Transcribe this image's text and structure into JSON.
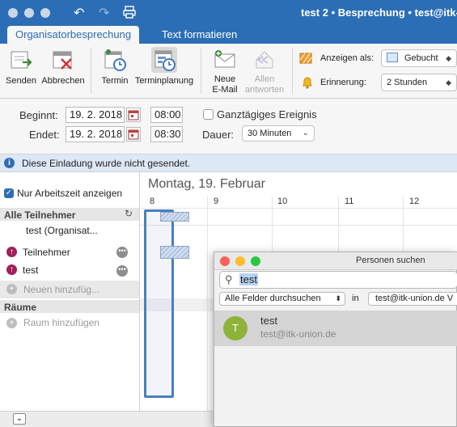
{
  "window": {
    "title": "test 2 • Besprechung • test@itk-"
  },
  "tabs": [
    {
      "label": "Organisatorbesprechung",
      "active": true
    },
    {
      "label": "Text formatieren",
      "active": false
    }
  ],
  "ribbon": {
    "buttons": [
      {
        "label": "Senden"
      },
      {
        "label": "Abbrechen"
      },
      {
        "label": "Termin"
      },
      {
        "label": "Terminplanung"
      },
      {
        "label_line1": "Neue",
        "label_line2": "E-Mail"
      },
      {
        "label_line1": "Allen",
        "label_line2": "antworten"
      }
    ],
    "show_as": {
      "label": "Anzeigen als:",
      "value": "Gebucht"
    },
    "reminder": {
      "label": "Erinnerung:",
      "value": "2 Stunden"
    }
  },
  "dates": {
    "start_label": "Beginnt:",
    "start_date": "19.  2. 2018",
    "start_time": "08:00",
    "end_label": "Endet:",
    "end_date": "19.  2. 2018",
    "end_time": "08:30",
    "allday_label": "Ganztägiges Ereignis",
    "duration_label": "Dauer:",
    "duration_value": "30 Minuten"
  },
  "info": {
    "message": "Diese Einladung wurde nicht gesendet."
  },
  "attendees": {
    "working_hours_label": "Nur Arbeitszeit anzeigen",
    "all_label": "Alle Teilnehmer",
    "organizer": "test (Organisat...",
    "people": [
      "Teilnehmer",
      "test"
    ],
    "add_placeholder": "Neuen hinzufüg...",
    "rooms_label": "Räume",
    "add_room": "Raum hinzufügen"
  },
  "schedule": {
    "day_title": "Montag, 19. Februar",
    "hours": [
      "8",
      "9",
      "10",
      "11",
      "12"
    ]
  },
  "popup": {
    "title": "Personen suchen",
    "search_value": "test",
    "filter": "Alle Felder durchsuchen",
    "in_label": "in",
    "account": "test@itk-union.de V",
    "result": {
      "initial": "T",
      "name": "test",
      "email": "test@itk-union.de"
    }
  },
  "colors": {
    "accent": "#2c6eb5",
    "info_icon": "#2c6eb5",
    "attendee_icon": "#a0205a",
    "avatar": "#8db33a",
    "selection": "#4a7fc1"
  }
}
